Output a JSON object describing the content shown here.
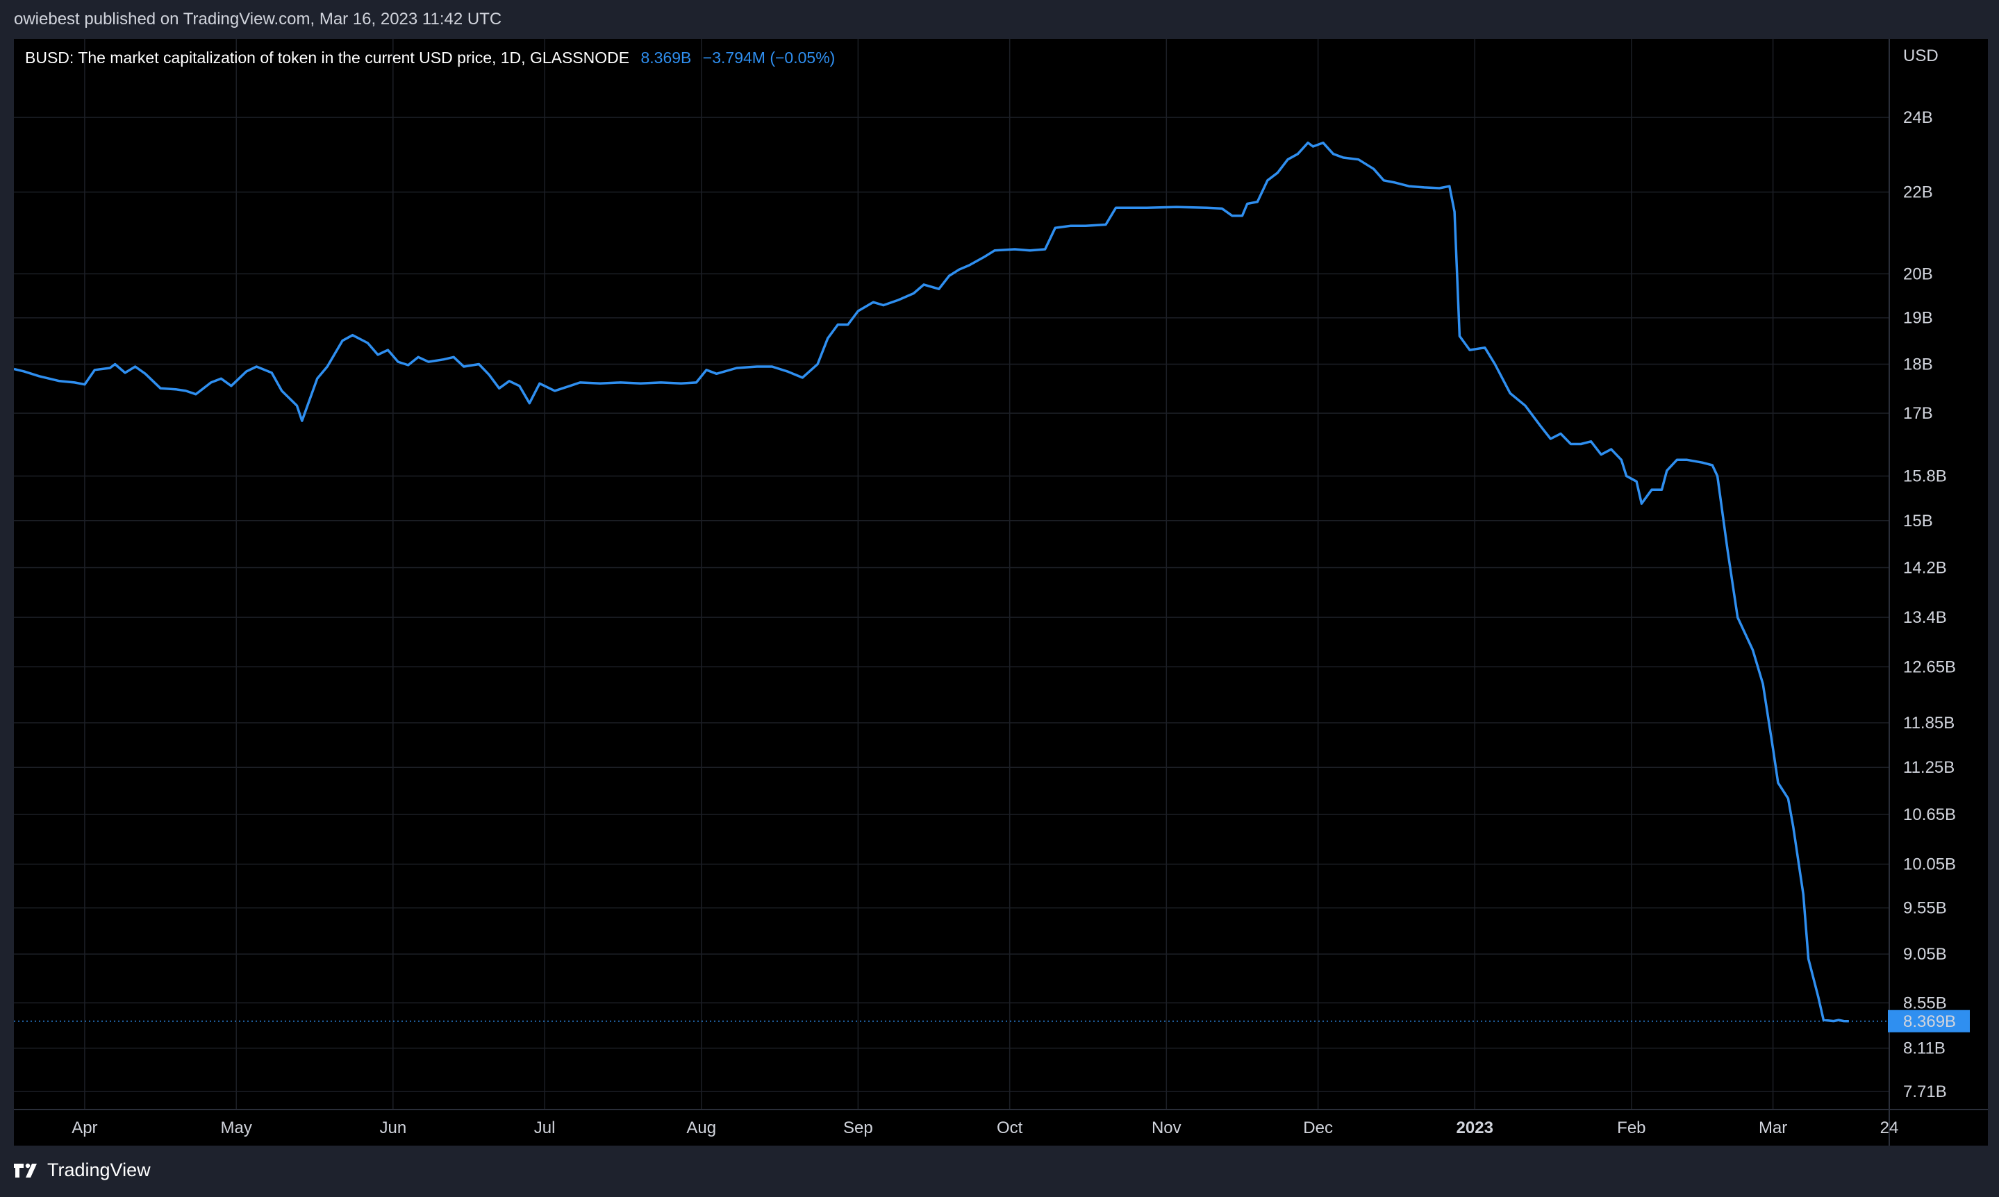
{
  "header": {
    "published": "owiebest published on TradingView.com, Mar 16, 2023 11:42 UTC"
  },
  "legend": {
    "title": "BUSD: The market capitalization of token in the current USD price, 1D, GLASSNODE",
    "value": "8.369B",
    "change": "−3.794M (−0.05%)"
  },
  "footer": {
    "brand": "TradingView",
    "logo_icon": "tradingview-logo-icon"
  },
  "colors": {
    "line": "#2f8ff0",
    "background": "#000000",
    "panel": "#1e222d",
    "grid": "#1c1f26",
    "text": "#d1d4dc",
    "price_tag": "#2f8ff0"
  },
  "chart_data": {
    "type": "line",
    "title": "BUSD: The market capitalization of token in the current USD price, 1D, GLASSNODE",
    "currency_label": "USD",
    "y_scale": "log",
    "ylim": [
      7.55,
      26.3
    ],
    "xlim": [
      "2022-03-18",
      "2023-03-24"
    ],
    "grid": true,
    "last_value_label": "8.369B",
    "last_value": 8.369,
    "y_ticks": [
      {
        "label": "24B",
        "value": 24
      },
      {
        "label": "22B",
        "value": 22
      },
      {
        "label": "20B",
        "value": 20
      },
      {
        "label": "19B",
        "value": 19
      },
      {
        "label": "18B",
        "value": 18
      },
      {
        "label": "17B",
        "value": 17
      },
      {
        "label": "15.8B",
        "value": 15.8
      },
      {
        "label": "15B",
        "value": 15
      },
      {
        "label": "14.2B",
        "value": 14.2
      },
      {
        "label": "13.4B",
        "value": 13.4
      },
      {
        "label": "12.65B",
        "value": 12.65
      },
      {
        "label": "11.85B",
        "value": 11.85
      },
      {
        "label": "11.25B",
        "value": 11.25
      },
      {
        "label": "10.65B",
        "value": 10.65
      },
      {
        "label": "10.05B",
        "value": 10.05
      },
      {
        "label": "9.55B",
        "value": 9.55
      },
      {
        "label": "9.05B",
        "value": 9.05
      },
      {
        "label": "8.55B",
        "value": 8.55
      },
      {
        "label": "8.11B",
        "value": 8.11
      },
      {
        "label": "7.71B",
        "value": 7.71
      }
    ],
    "x_ticks": [
      {
        "label": "Apr",
        "date": "2022-04-01",
        "bold": false
      },
      {
        "label": "May",
        "date": "2022-05-01",
        "bold": false
      },
      {
        "label": "Jun",
        "date": "2022-06-01",
        "bold": false
      },
      {
        "label": "Jul",
        "date": "2022-07-01",
        "bold": false
      },
      {
        "label": "Aug",
        "date": "2022-08-01",
        "bold": false
      },
      {
        "label": "Sep",
        "date": "2022-09-01",
        "bold": false
      },
      {
        "label": "Oct",
        "date": "2022-10-01",
        "bold": false
      },
      {
        "label": "Nov",
        "date": "2022-11-01",
        "bold": false
      },
      {
        "label": "Dec",
        "date": "2022-12-01",
        "bold": false
      },
      {
        "label": "2023",
        "date": "2023-01-01",
        "bold": true
      },
      {
        "label": "Feb",
        "date": "2023-02-01",
        "bold": false
      },
      {
        "label": "Mar",
        "date": "2023-03-01",
        "bold": false
      },
      {
        "label": "24",
        "date": "2023-03-24",
        "bold": false
      }
    ],
    "series": [
      {
        "points": [
          [
            "2022-03-18",
            17.9
          ],
          [
            "2022-03-20",
            17.85
          ],
          [
            "2022-03-23",
            17.75
          ],
          [
            "2022-03-27",
            17.65
          ],
          [
            "2022-03-30",
            17.62
          ],
          [
            "2022-04-01",
            17.58
          ],
          [
            "2022-04-03",
            17.88
          ],
          [
            "2022-04-06",
            17.92
          ],
          [
            "2022-04-07",
            18.0
          ],
          [
            "2022-04-09",
            17.82
          ],
          [
            "2022-04-11",
            17.95
          ],
          [
            "2022-04-13",
            17.8
          ],
          [
            "2022-04-16",
            17.5
          ],
          [
            "2022-04-19",
            17.48
          ],
          [
            "2022-04-21",
            17.45
          ],
          [
            "2022-04-23",
            17.38
          ],
          [
            "2022-04-26",
            17.62
          ],
          [
            "2022-04-28",
            17.7
          ],
          [
            "2022-04-30",
            17.55
          ],
          [
            "2022-05-03",
            17.85
          ],
          [
            "2022-05-05",
            17.95
          ],
          [
            "2022-05-08",
            17.82
          ],
          [
            "2022-05-10",
            17.45
          ],
          [
            "2022-05-13",
            17.15
          ],
          [
            "2022-05-14",
            16.85
          ],
          [
            "2022-05-17",
            17.7
          ],
          [
            "2022-05-19",
            17.95
          ],
          [
            "2022-05-22",
            18.5
          ],
          [
            "2022-05-24",
            18.62
          ],
          [
            "2022-05-27",
            18.45
          ],
          [
            "2022-05-29",
            18.2
          ],
          [
            "2022-05-31",
            18.3
          ],
          [
            "2022-06-02",
            18.05
          ],
          [
            "2022-06-04",
            17.98
          ],
          [
            "2022-06-06",
            18.15
          ],
          [
            "2022-06-08",
            18.05
          ],
          [
            "2022-06-11",
            18.1
          ],
          [
            "2022-06-13",
            18.15
          ],
          [
            "2022-06-15",
            17.95
          ],
          [
            "2022-06-18",
            18.0
          ],
          [
            "2022-06-20",
            17.78
          ],
          [
            "2022-06-22",
            17.5
          ],
          [
            "2022-06-24",
            17.65
          ],
          [
            "2022-06-26",
            17.55
          ],
          [
            "2022-06-28",
            17.2
          ],
          [
            "2022-06-30",
            17.6
          ],
          [
            "2022-07-03",
            17.45
          ],
          [
            "2022-07-06",
            17.55
          ],
          [
            "2022-07-08",
            17.62
          ],
          [
            "2022-07-12",
            17.6
          ],
          [
            "2022-07-16",
            17.62
          ],
          [
            "2022-07-20",
            17.6
          ],
          [
            "2022-07-24",
            17.62
          ],
          [
            "2022-07-28",
            17.6
          ],
          [
            "2022-07-31",
            17.62
          ],
          [
            "2022-08-02",
            17.88
          ],
          [
            "2022-08-04",
            17.8
          ],
          [
            "2022-08-08",
            17.92
          ],
          [
            "2022-08-12",
            17.95
          ],
          [
            "2022-08-15",
            17.95
          ],
          [
            "2022-08-18",
            17.85
          ],
          [
            "2022-08-21",
            17.72
          ],
          [
            "2022-08-24",
            18.0
          ],
          [
            "2022-08-26",
            18.55
          ],
          [
            "2022-08-28",
            18.85
          ],
          [
            "2022-08-30",
            18.85
          ],
          [
            "2022-09-01",
            19.15
          ],
          [
            "2022-09-04",
            19.35
          ],
          [
            "2022-09-06",
            19.28
          ],
          [
            "2022-09-09",
            19.4
          ],
          [
            "2022-09-12",
            19.55
          ],
          [
            "2022-09-14",
            19.75
          ],
          [
            "2022-09-17",
            19.65
          ],
          [
            "2022-09-19",
            19.95
          ],
          [
            "2022-09-21",
            20.1
          ],
          [
            "2022-09-23",
            20.2
          ],
          [
            "2022-09-26",
            20.4
          ],
          [
            "2022-09-28",
            20.55
          ],
          [
            "2022-10-02",
            20.58
          ],
          [
            "2022-10-05",
            20.55
          ],
          [
            "2022-10-08",
            20.58
          ],
          [
            "2022-10-10",
            21.1
          ],
          [
            "2022-10-13",
            21.15
          ],
          [
            "2022-10-16",
            21.15
          ],
          [
            "2022-10-20",
            21.18
          ],
          [
            "2022-10-22",
            21.6
          ],
          [
            "2022-10-28",
            21.6
          ],
          [
            "2022-11-03",
            21.62
          ],
          [
            "2022-11-09",
            21.6
          ],
          [
            "2022-11-12",
            21.58
          ],
          [
            "2022-11-14",
            21.4
          ],
          [
            "2022-11-16",
            21.4
          ],
          [
            "2022-11-17",
            21.7
          ],
          [
            "2022-11-19",
            21.75
          ],
          [
            "2022-11-21",
            22.3
          ],
          [
            "2022-11-23",
            22.5
          ],
          [
            "2022-11-25",
            22.85
          ],
          [
            "2022-11-27",
            23.0
          ],
          [
            "2022-11-29",
            23.3
          ],
          [
            "2022-11-30",
            23.2
          ],
          [
            "2022-12-02",
            23.3
          ],
          [
            "2022-12-04",
            23.0
          ],
          [
            "2022-12-06",
            22.9
          ],
          [
            "2022-12-09",
            22.85
          ],
          [
            "2022-12-12",
            22.6
          ],
          [
            "2022-12-14",
            22.3
          ],
          [
            "2022-12-16",
            22.25
          ],
          [
            "2022-12-19",
            22.15
          ],
          [
            "2022-12-22",
            22.12
          ],
          [
            "2022-12-25",
            22.1
          ],
          [
            "2022-12-27",
            22.15
          ],
          [
            "2022-12-28",
            21.5
          ],
          [
            "2022-12-29",
            18.6
          ],
          [
            "2022-12-31",
            18.3
          ],
          [
            "2023-01-03",
            18.35
          ],
          [
            "2023-01-05",
            18.0
          ],
          [
            "2023-01-08",
            17.4
          ],
          [
            "2023-01-11",
            17.15
          ],
          [
            "2023-01-14",
            16.75
          ],
          [
            "2023-01-16",
            16.5
          ],
          [
            "2023-01-18",
            16.6
          ],
          [
            "2023-01-20",
            16.4
          ],
          [
            "2023-01-22",
            16.4
          ],
          [
            "2023-01-24",
            16.45
          ],
          [
            "2023-01-26",
            16.2
          ],
          [
            "2023-01-28",
            16.3
          ],
          [
            "2023-01-30",
            16.1
          ],
          [
            "2023-01-31",
            15.8
          ],
          [
            "2023-02-02",
            15.7
          ],
          [
            "2023-02-03",
            15.3
          ],
          [
            "2023-02-05",
            15.55
          ],
          [
            "2023-02-07",
            15.55
          ],
          [
            "2023-02-08",
            15.9
          ],
          [
            "2023-02-10",
            16.1
          ],
          [
            "2023-02-12",
            16.1
          ],
          [
            "2023-02-15",
            16.05
          ],
          [
            "2023-02-17",
            16.0
          ],
          [
            "2023-02-18",
            15.8
          ],
          [
            "2023-02-20",
            14.5
          ],
          [
            "2023-02-22",
            13.4
          ],
          [
            "2023-02-25",
            12.9
          ],
          [
            "2023-02-27",
            12.4
          ],
          [
            "2023-03-01",
            11.5
          ],
          [
            "2023-03-02",
            11.05
          ],
          [
            "2023-03-04",
            10.85
          ],
          [
            "2023-03-05",
            10.5
          ],
          [
            "2023-03-07",
            9.7
          ],
          [
            "2023-03-08",
            9.0
          ],
          [
            "2023-03-10",
            8.6
          ],
          [
            "2023-03-11",
            8.38
          ],
          [
            "2023-03-13",
            8.37
          ],
          [
            "2023-03-14",
            8.38
          ],
          [
            "2023-03-15",
            8.37
          ],
          [
            "2023-03-16",
            8.369
          ]
        ]
      }
    ]
  }
}
